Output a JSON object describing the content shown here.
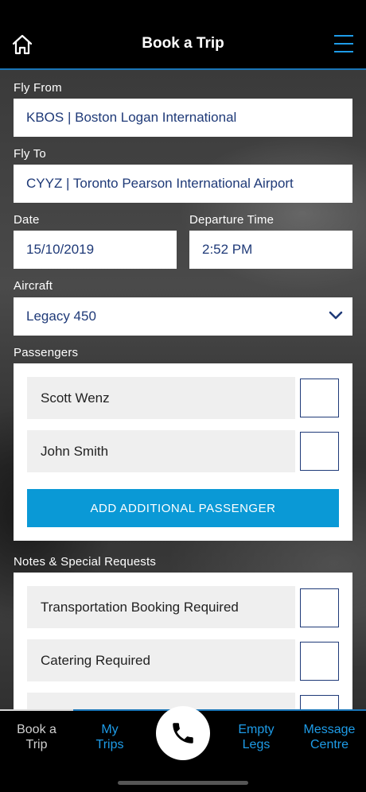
{
  "header": {
    "title": "Book a Trip"
  },
  "form": {
    "fly_from_label": "Fly From",
    "fly_from_value": "KBOS | Boston Logan International",
    "fly_to_label": "Fly To",
    "fly_to_value": "CYYZ | Toronto Pearson International Airport",
    "date_label": "Date",
    "date_value": "15/10/2019",
    "time_label": "Departure Time",
    "time_value": "2:52 PM",
    "aircraft_label": "Aircraft",
    "aircraft_value": "Legacy 450"
  },
  "passengers": {
    "label": "Passengers",
    "items": [
      {
        "name": "Scott Wenz",
        "checked": false
      },
      {
        "name": "John Smith",
        "checked": false
      }
    ],
    "add_button": "ADD ADDITIONAL PASSENGER"
  },
  "notes": {
    "label": "Notes & Special Requests",
    "items": [
      {
        "label": "Transportation Booking Required",
        "checked": false
      },
      {
        "label": "Catering Required",
        "checked": false
      }
    ]
  },
  "tabbar": {
    "tabs": [
      {
        "line1": "Book a",
        "line2": "Trip"
      },
      {
        "line1": "My",
        "line2": "Trips"
      },
      {
        "line1": "Empty",
        "line2": "Legs"
      },
      {
        "line1": "Message",
        "line2": "Centre"
      }
    ],
    "active_index": 0
  },
  "colors": {
    "accent": "#0a99d6",
    "link": "#1e9ce8",
    "field_text": "#1f3a78"
  },
  "icons": {
    "home": "home-icon",
    "menu": "hamburger-menu-icon",
    "call": "phone-icon",
    "dropdown": "chevron-down-icon"
  }
}
